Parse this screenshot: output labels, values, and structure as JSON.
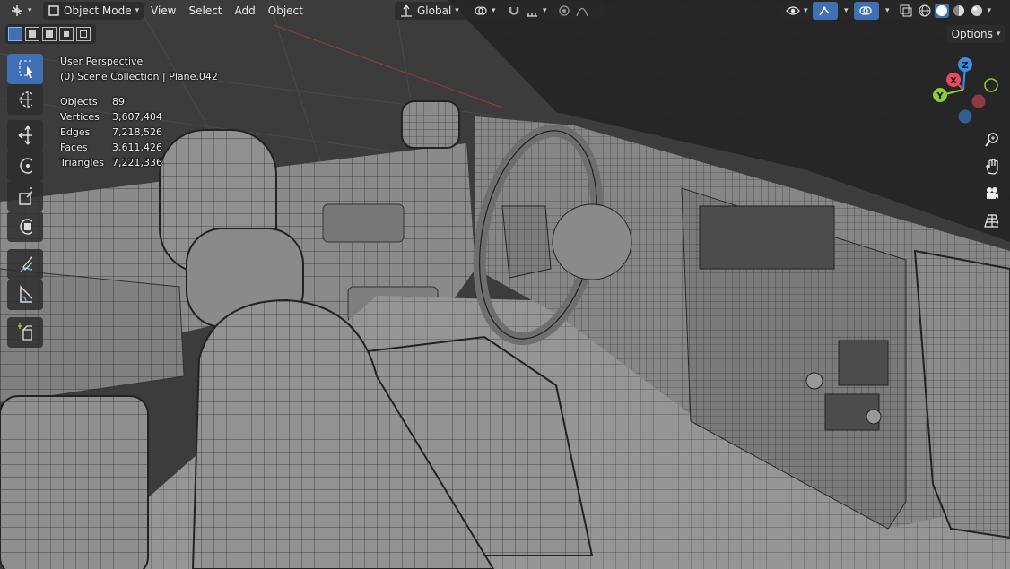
{
  "header": {
    "mode": "Object Mode",
    "menus": [
      "View",
      "Select",
      "Add",
      "Object"
    ],
    "orientation": "Global"
  },
  "options_label": "Options",
  "viewport_info": {
    "perspective": "User Perspective",
    "collection": "(0) Scene Collection | Plane.042"
  },
  "stats": [
    {
      "label": "Objects",
      "value": "89"
    },
    {
      "label": "Vertices",
      "value": "3,607,404"
    },
    {
      "label": "Edges",
      "value": "7,218,526"
    },
    {
      "label": "Faces",
      "value": "3,611,426"
    },
    {
      "label": "Triangles",
      "value": "7,221,336"
    }
  ],
  "gizmo": {
    "axes": [
      "Z",
      "X",
      "Y"
    ],
    "colors": {
      "x": "#e84a5f",
      "y": "#8fcc34",
      "z": "#3a8ee6"
    }
  },
  "toolbar_tools": [
    "select-box",
    "cursor",
    "move",
    "rotate",
    "scale",
    "transform",
    "annotate",
    "measure",
    "add-cube"
  ],
  "colors": {
    "accent": "#3f6fb5",
    "background": "#3a3a3a",
    "mesh_surface": "#8d8d8d",
    "wire": "#1e1e1e"
  }
}
